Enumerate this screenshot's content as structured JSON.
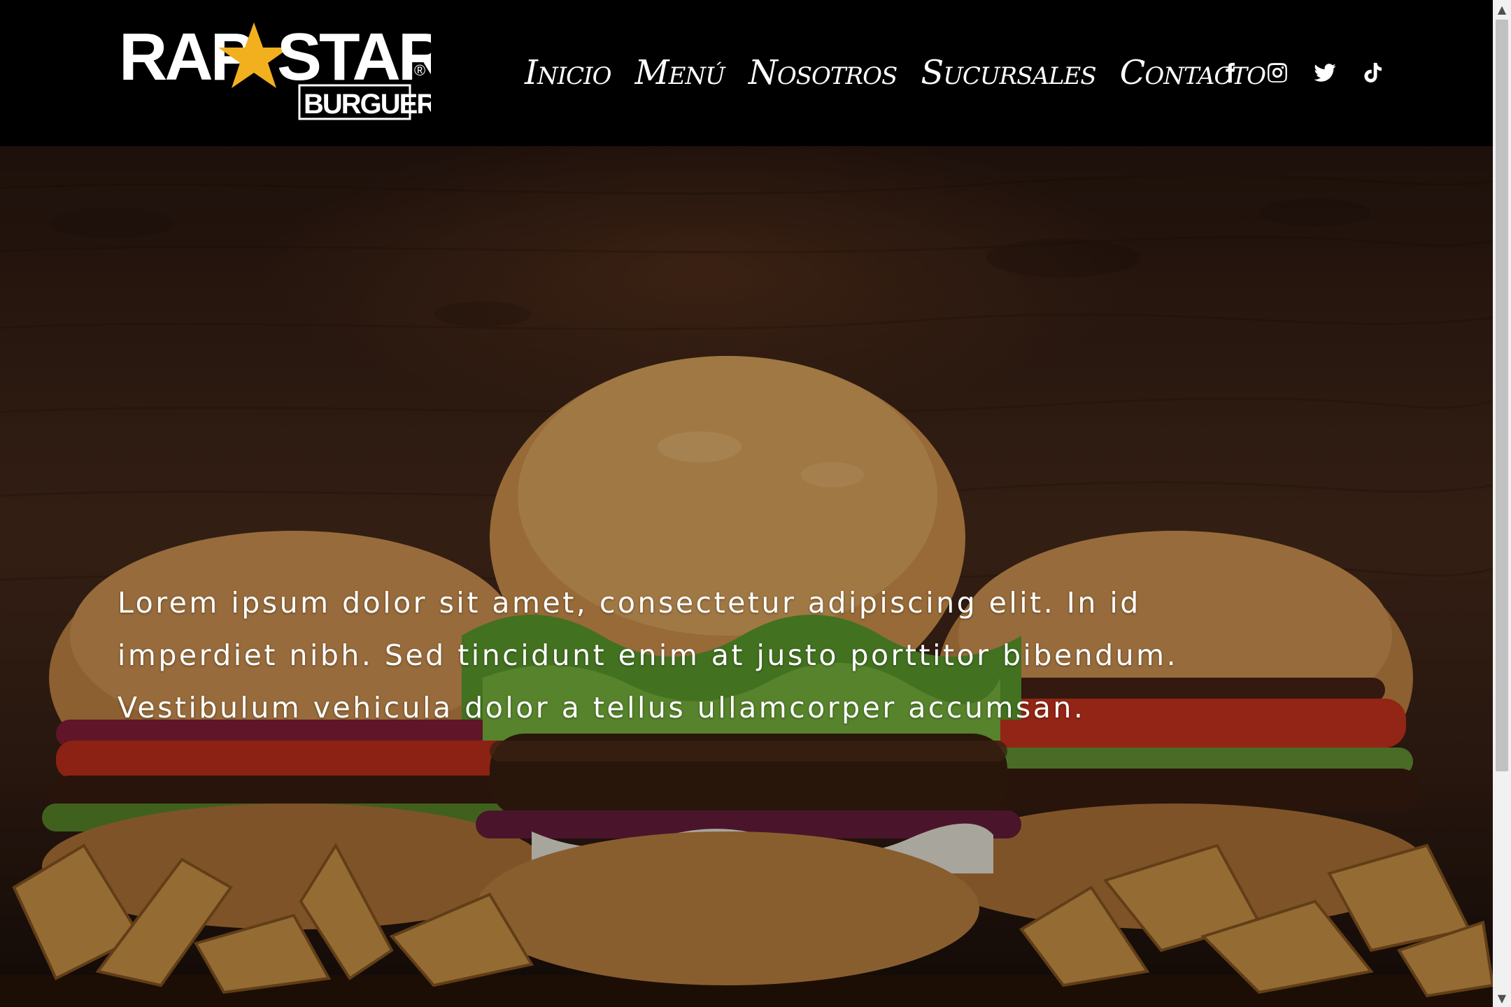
{
  "brand": {
    "name_part1": "RAP",
    "name_part2": "STAR",
    "subtitle": "BURGUERS",
    "registered": "®",
    "star_color": "#f2b01e"
  },
  "nav": {
    "items": [
      {
        "label": "Inicio"
      },
      {
        "label": "Menú"
      },
      {
        "label": "Nosotros"
      },
      {
        "label": "Sucursales"
      },
      {
        "label": "Contacto"
      }
    ]
  },
  "social": {
    "icons": [
      "facebook-icon",
      "instagram-icon",
      "twitter-icon",
      "tiktok-icon"
    ]
  },
  "hero": {
    "text": "Lorem ipsum dolor sit amet, consectetur adipiscing elit. In id imperdiet nibh. Sed tincidunt enim at justo porttitor bibendum. Vestibulum vehicula dolor a tellus ullamcorper accumsan.",
    "image": "burgers-and-fries-photo"
  },
  "colors": {
    "header_bg": "#000000",
    "text": "#ffffff",
    "wood": "#4a2c1c"
  }
}
